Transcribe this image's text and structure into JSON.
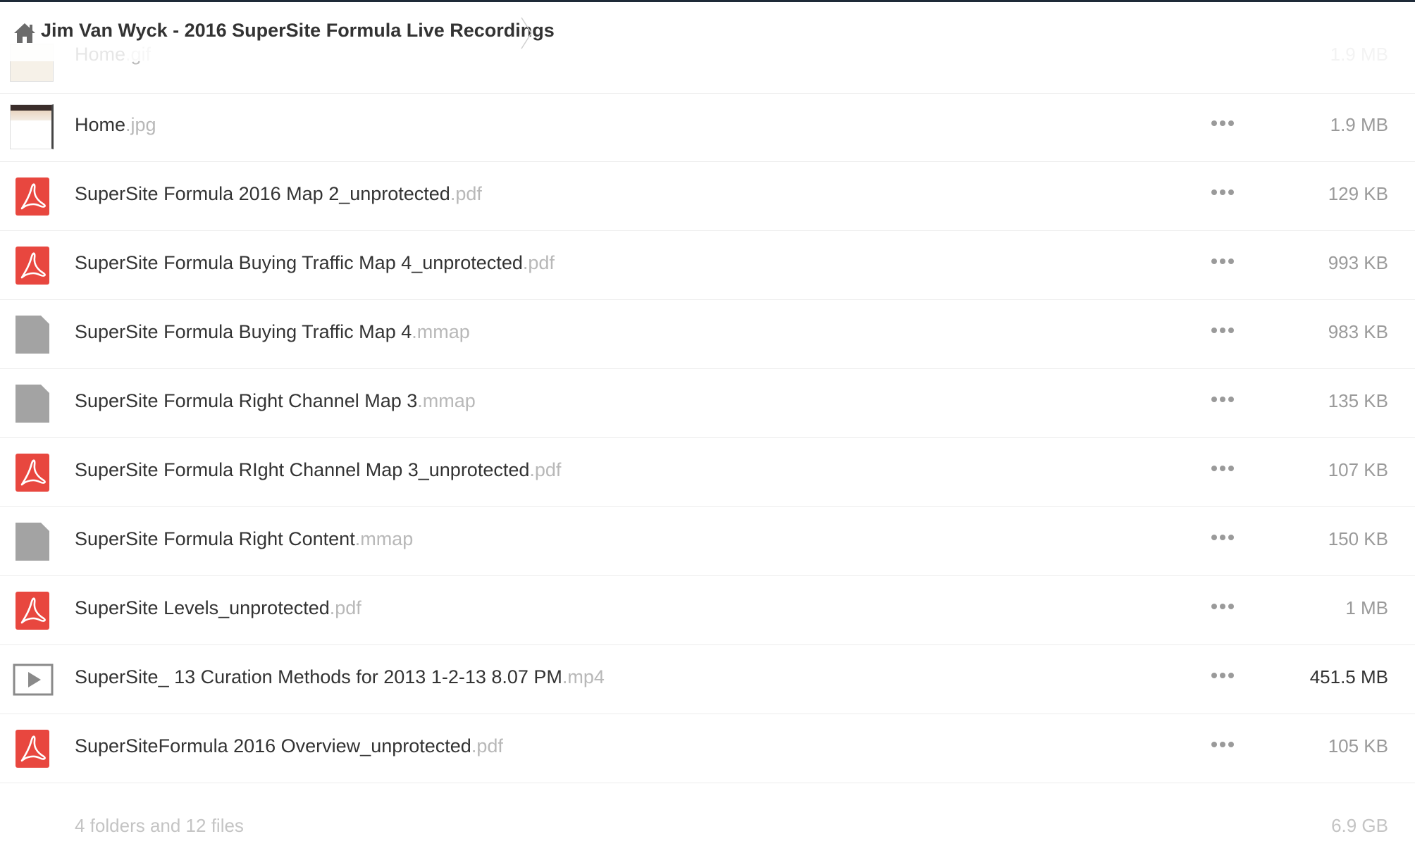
{
  "breadcrumb": {
    "home_icon": "home-icon",
    "title": "Jim Van Wyck - 2016 SuperSite Formula Live Recordings"
  },
  "partial_row": {
    "name": "Home",
    "ext": ".gif",
    "size": "1.9 MB",
    "icon": "image-thumbnail"
  },
  "files": [
    {
      "name": "Home",
      "ext": ".jpg",
      "size": "1.9 MB",
      "icon": "image-thumbnail",
      "size_dark": false
    },
    {
      "name": "SuperSite Formula 2016 Map 2_unprotected",
      "ext": ".pdf",
      "size": "129 KB",
      "icon": "pdf-icon",
      "size_dark": false
    },
    {
      "name": "SuperSite Formula Buying Traffic Map 4_unprotected",
      "ext": ".pdf",
      "size": "993 KB",
      "icon": "pdf-icon",
      "size_dark": false
    },
    {
      "name": "SuperSite Formula Buying Traffic Map 4",
      "ext": ".mmap",
      "size": "983 KB",
      "icon": "file-icon",
      "size_dark": false
    },
    {
      "name": "SuperSite Formula Right Channel Map 3",
      "ext": ".mmap",
      "size": "135 KB",
      "icon": "file-icon",
      "size_dark": false
    },
    {
      "name": "SuperSite Formula RIght Channel Map 3_unprotected",
      "ext": ".pdf",
      "size": "107 KB",
      "icon": "pdf-icon",
      "size_dark": false
    },
    {
      "name": "SuperSite Formula Right Content",
      "ext": ".mmap",
      "size": "150 KB",
      "icon": "file-icon",
      "size_dark": false
    },
    {
      "name": "SuperSite Levels_unprotected",
      "ext": ".pdf",
      "size": "1 MB",
      "icon": "pdf-icon",
      "size_dark": false
    },
    {
      "name": "SuperSite_ 13 Curation Methods for 2013 1-2-13 8.07 PM",
      "ext": ".mp4",
      "size": "451.5 MB",
      "icon": "video-icon",
      "size_dark": true
    },
    {
      "name": "SuperSiteFormula 2016 Overview_unprotected",
      "ext": ".pdf",
      "size": "105 KB",
      "icon": "pdf-icon",
      "size_dark": false
    }
  ],
  "summary": {
    "count_text": "4 folders and 12 files",
    "total_size": "6.9 GB"
  },
  "colors": {
    "pdf_red": "#e8473f",
    "file_gray": "#a3a3a3",
    "ext_gray": "#b8b8b8",
    "border": "#ececec"
  }
}
